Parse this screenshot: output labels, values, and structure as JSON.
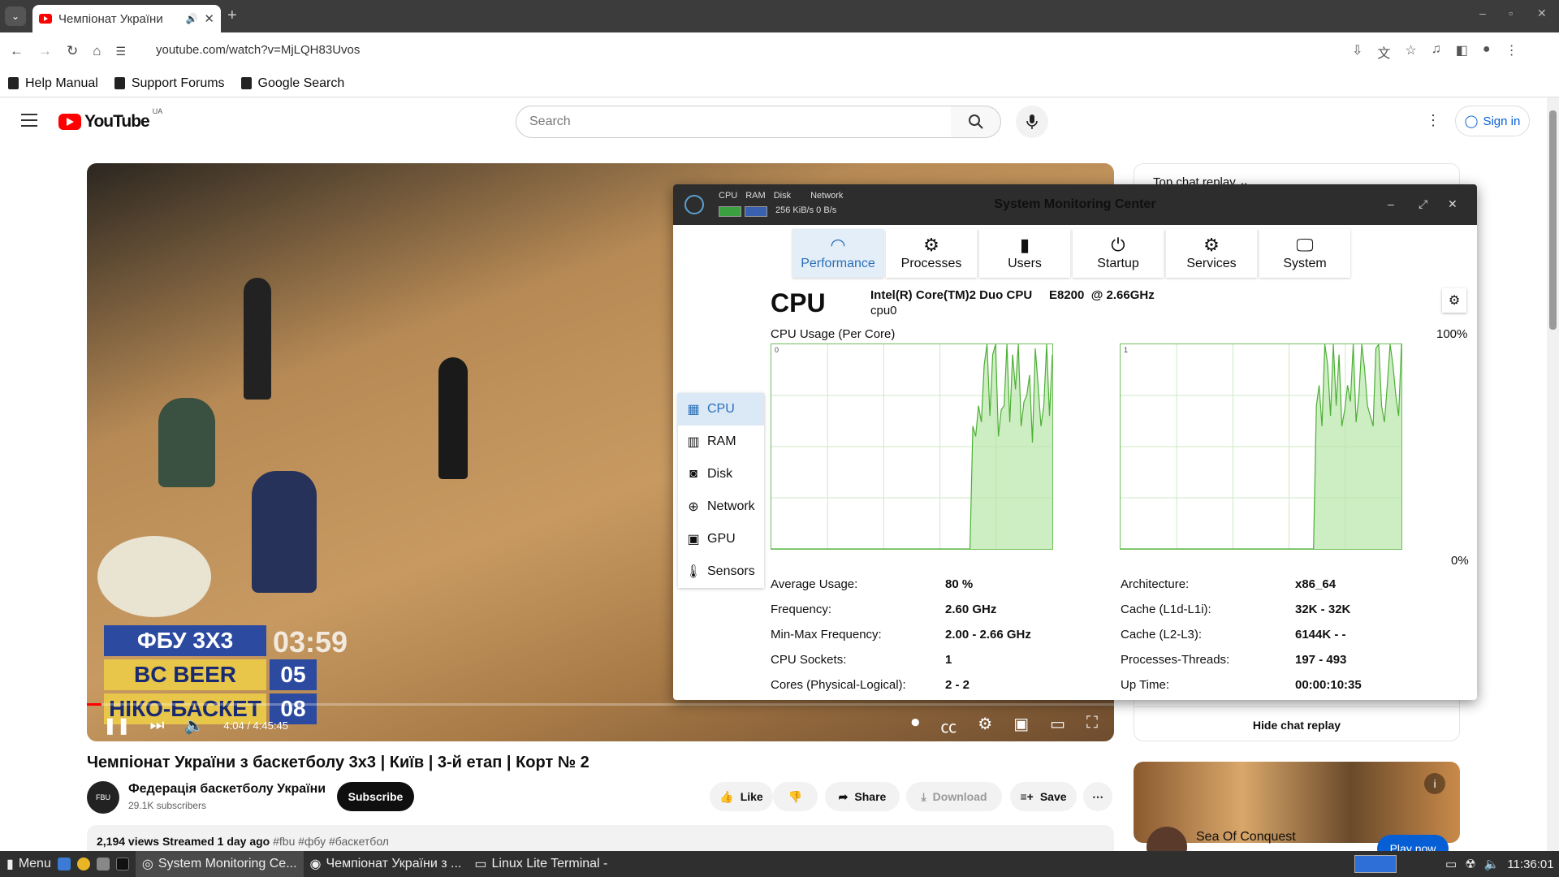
{
  "browser": {
    "tab_title": "Чемпіонат України",
    "url": "youtube.com/watch?v=MjLQH83Uvos",
    "bookmarks": [
      "Help Manual",
      "Support Forums",
      "Google Search"
    ]
  },
  "youtube": {
    "logo_text": "YouTube",
    "country": "UA",
    "search_placeholder": "Search",
    "sign_in": "Sign in",
    "video": {
      "time": "4:04 / 4:45:45",
      "progress_fraction": 0.0142,
      "scoreboard": {
        "event": "ФБУ 3Х3",
        "clock": "03:59",
        "team1": "BC BEER",
        "score1": "05",
        "team2": "НІКО-БАСКЕТ",
        "score2": "08"
      }
    },
    "title": "Чемпіонат України з баскетболу 3х3 | Київ | 3-й етап | Корт № 2",
    "channel": {
      "name": "Федерація баскетболу України",
      "subscribers": "29.1K subscribers",
      "avatar_text": "FBU"
    },
    "subscribe": "Subscribe",
    "actions": {
      "like": "Like",
      "share": "Share",
      "download": "Download",
      "save": "Save"
    },
    "description": {
      "stats": "2,194 views  Streamed 1 day ago",
      "tags": "#fbu #фбу #баскетбол"
    },
    "chat": {
      "top": "Top chat replay",
      "hide": "Hide chat replay"
    },
    "ad": {
      "title": "Sea Of Conquest",
      "button": "Play now"
    }
  },
  "smc": {
    "title": "System Monitoring Center",
    "mini_labels": [
      "CPU",
      "RAM",
      "Disk",
      "Network"
    ],
    "mini_rate": "256 KiB/s 0 B/s",
    "tabs": [
      {
        "label": "Performance",
        "icon": "gauge-icon"
      },
      {
        "label": "Processes",
        "icon": "gear-icon"
      },
      {
        "label": "Users",
        "icon": "mouse-icon"
      },
      {
        "label": "Startup",
        "icon": "power-icon"
      },
      {
        "label": "Services",
        "icon": "gears-icon"
      },
      {
        "label": "System",
        "icon": "monitor-icon"
      }
    ],
    "sidebar": [
      {
        "label": "CPU",
        "icon": "cpu-icon"
      },
      {
        "label": "RAM",
        "icon": "ram-icon"
      },
      {
        "label": "Disk",
        "icon": "disk-icon"
      },
      {
        "label": "Network",
        "icon": "globe-icon"
      },
      {
        "label": "GPU",
        "icon": "gpu-icon"
      },
      {
        "label": "Sensors",
        "icon": "thermometer-icon"
      }
    ],
    "cpu": {
      "heading": "CPU",
      "model": "Intel(R) Core(TM)2 Duo CPU     E8200  @ 2.66GHz",
      "device": "cpu0",
      "graph_label": "CPU Usage (Per Core)",
      "max": "100%",
      "min": "0%",
      "cores": [
        {
          "label": "0",
          "usage": [
            0,
            0,
            0,
            0,
            0,
            0,
            0,
            0,
            0,
            0,
            0,
            0,
            0,
            0,
            0,
            0,
            0,
            0,
            0,
            0,
            0,
            0,
            0,
            0,
            0,
            0,
            0,
            0,
            0,
            0,
            0,
            0,
            0,
            0,
            0,
            0,
            0,
            0,
            0,
            0,
            0,
            0,
            0,
            0,
            0,
            0,
            0,
            0,
            0,
            0,
            0,
            0,
            0,
            0,
            0,
            0,
            0,
            0,
            0,
            0,
            0,
            0,
            0,
            0,
            0,
            0,
            0,
            0,
            0,
            0,
            0,
            60,
            55,
            70,
            62,
            90,
            100,
            65,
            95,
            100,
            55,
            68,
            70,
            100,
            62,
            95,
            78,
            100,
            60,
            72,
            75,
            85,
            52,
            98,
            80,
            60,
            70,
            100,
            65,
            95
          ]
        },
        {
          "label": "1",
          "usage": [
            0,
            0,
            0,
            0,
            0,
            0,
            0,
            0,
            0,
            0,
            0,
            0,
            0,
            0,
            0,
            0,
            0,
            0,
            0,
            0,
            0,
            0,
            0,
            0,
            0,
            0,
            0,
            0,
            0,
            0,
            0,
            0,
            0,
            0,
            0,
            0,
            0,
            0,
            0,
            0,
            0,
            0,
            0,
            0,
            0,
            0,
            0,
            0,
            0,
            0,
            0,
            0,
            0,
            0,
            0,
            0,
            0,
            0,
            0,
            0,
            0,
            0,
            0,
            0,
            0,
            0,
            0,
            0,
            0,
            70,
            80,
            60,
            100,
            90,
            65,
            100,
            70,
            95,
            60,
            68,
            80,
            72,
            100,
            62,
            75,
            100,
            88,
            70,
            65,
            60,
            98,
            100,
            70,
            62,
            80,
            100,
            90,
            75,
            65,
            100
          ]
        }
      ],
      "stats_left": [
        {
          "label": "Average Usage:",
          "value": "80 %"
        },
        {
          "label": "Frequency:",
          "value": "2.60 GHz"
        },
        {
          "label": "Min-Max Frequency:",
          "value": "2.00 - 2.66 GHz"
        },
        {
          "label": "CPU Sockets:",
          "value": "1"
        },
        {
          "label": "Cores (Physical-Logical):",
          "value": "2 - 2"
        }
      ],
      "stats_right": [
        {
          "label": "Architecture:",
          "value": "x86_64"
        },
        {
          "label": "Cache (L1d-L1i):",
          "value": "32K - 32K"
        },
        {
          "label": "Cache (L2-L3):",
          "value": "6144K - -"
        },
        {
          "label": "Processes-Threads:",
          "value": "197 - 493"
        },
        {
          "label": "Up Time:",
          "value": "00:00:10:35"
        }
      ]
    }
  },
  "taskbar": {
    "menu": "Menu",
    "windows": [
      "System Monitoring Ce...",
      "Чемпіонат України з ...",
      "Linux Lite Terminal -"
    ],
    "clock": "11:36:01"
  }
}
